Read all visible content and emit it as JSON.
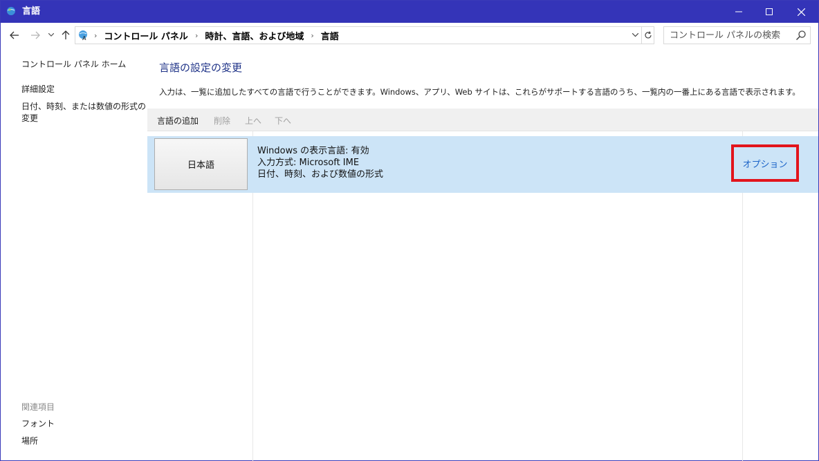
{
  "window": {
    "title": "言語",
    "accent": "#3434b8"
  },
  "navigation": {
    "breadcrumbs": [
      "コントロール パネル",
      "時計、言語、および地域",
      "言語"
    ]
  },
  "search": {
    "placeholder": "コントロール パネルの検索"
  },
  "sidebar": {
    "links": [
      "コントロール パネル ホーム",
      "詳細設定",
      "日付、時刻、または数値の形式の変更"
    ],
    "related_heading": "関連項目",
    "related_links": [
      "フォント",
      "場所"
    ]
  },
  "main": {
    "heading": "言語の設定の変更",
    "description": "入力は、一覧に追加したすべての言語で行うことができます。Windows、アプリ、Web サイトは、これらがサポートする言語のうち、一覧内の一番上にある言語で表示されます。",
    "toolbar": {
      "add": "言語の追加",
      "remove": "削除",
      "up": "上へ",
      "down": "下へ"
    },
    "languages": [
      {
        "name": "日本語",
        "display_language": "Windows の表示言語: 有効",
        "input_method": "入力方式: Microsoft IME",
        "format": "日付、時刻、および数値の形式",
        "options_label": "オプション"
      }
    ],
    "highlight_color": "#e2141c",
    "selection_color": "#cce4f7"
  }
}
